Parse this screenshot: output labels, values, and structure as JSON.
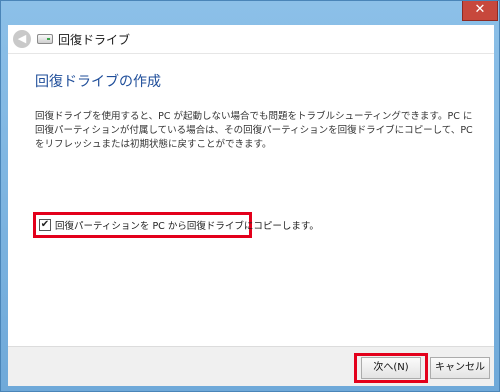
{
  "window": {
    "close_glyph": "✕"
  },
  "nav": {
    "back_glyph": "◀",
    "title": "回復ドライブ"
  },
  "content": {
    "heading": "回復ドライブの作成",
    "description": "回復ドライブを使用すると、PC が起動しない場合でも問題をトラブルシューティングできます。PC に回復パーティションが付属している場合は、その回復パーティションを回復ドライブにコピーして、PC をリフレッシュまたは初期状態に戻すことができます。",
    "option": {
      "checked": true,
      "check_glyph": "✔",
      "label": "回復パーティションを PC から回復ドライブにコピーします。"
    }
  },
  "footer": {
    "next_label": "次へ(N)",
    "cancel_label": "キャンセル"
  },
  "colors": {
    "highlight": "#e3001b",
    "heading": "#1f4e9a",
    "close_button": "#c7483c"
  }
}
